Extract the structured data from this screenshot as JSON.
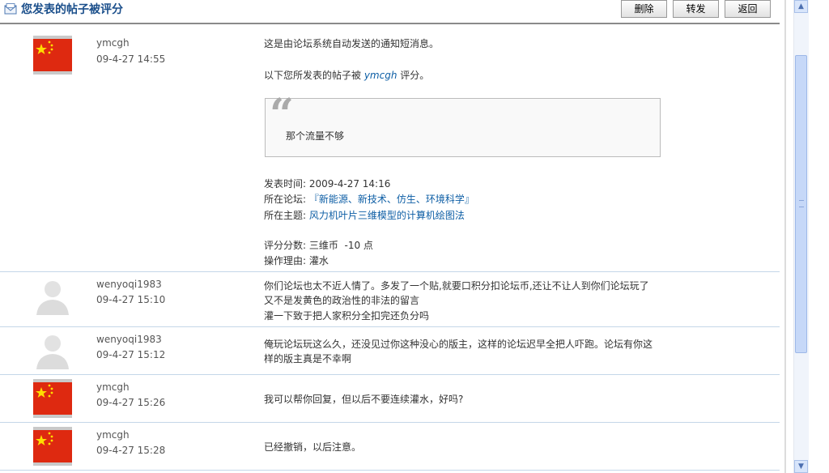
{
  "header": {
    "title": "您发表的帖子被评分",
    "buttons": {
      "delete": "删除",
      "forward": "转发",
      "back": "返回"
    }
  },
  "messages": [
    {
      "user": "ymcgh",
      "time": "09-4-27 14:55",
      "avatar": "china-flag",
      "intro": "这是由论坛系统自动发送的通知短消息。",
      "rated_prefix": "以下您所发表的帖子被 ",
      "rated_user": "ymcgh",
      "rated_suffix": " 评分。",
      "quote": "那个流量不够",
      "post_time_label": "发表时间: ",
      "post_time": "2009-4-27 14:16",
      "forum_label": "所在论坛: ",
      "forum": "『新能源、新技术、仿生、环境科学』",
      "topic_label": "所在主题: ",
      "topic": "风力机叶片三维模型的计算机绘图法",
      "score_label": "评分分数: ",
      "score": "三维币  -10 点",
      "reason_label": "操作理由: ",
      "reason": "灌水"
    },
    {
      "user": "wenyoqi1983",
      "time": "09-4-27 15:10",
      "avatar": "default-user",
      "lines": [
        "你们论坛也太不近人情了。多发了一个贴,就要口积分扣论坛币,还让不让人到你们论坛玩了",
        "又不是发黄色的政治性的非法的留言",
        "灌一下致于把人家积分全扣完还负分吗"
      ]
    },
    {
      "user": "wenyoqi1983",
      "time": "09-4-27 15:12",
      "avatar": "default-user",
      "lines": [
        "俺玩论坛玩这么久，还没见过你这种没心的版主，这样的论坛迟早全把人吓跑。论坛有你这",
        "样的版主真是不幸啊"
      ]
    },
    {
      "user": "ymcgh",
      "time": "09-4-27 15:26",
      "avatar": "china-flag",
      "lines": [
        "我可以帮你回复，但以后不要连续灌水，好吗?"
      ]
    },
    {
      "user": "ymcgh",
      "time": "09-4-27 15:28",
      "avatar": "china-flag",
      "lines": [
        "已经撤销，以后注意。"
      ]
    }
  ],
  "icons": {
    "title": "envelope-icon",
    "scroll_up": "arrow-up-icon",
    "scroll_down": "arrow-down-icon"
  },
  "colors": {
    "title": "#1b4f8b",
    "link": "#0d5ea5",
    "divider": "#c4d7e8"
  }
}
